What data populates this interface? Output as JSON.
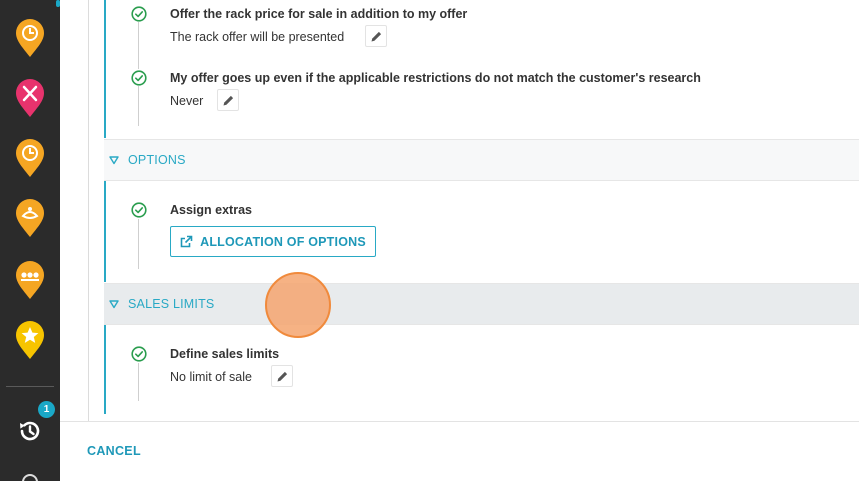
{
  "colors": {
    "sidebar_bg": "#2b2b2b",
    "accent": "#29a9c5",
    "link": "#1e98b8",
    "pin_orange": "#f5a623",
    "pin_pink": "#e8336d",
    "pin_yellow": "#f7c400",
    "cursor": "#f08a3c"
  },
  "sidebar": {
    "icons": [
      "clock-pin-icon",
      "restaurant-pin-icon",
      "clock-pin-icon",
      "spa-pin-icon",
      "group-pin-icon",
      "star-pin-icon"
    ],
    "history_badge": "1"
  },
  "rack_section": {
    "items": [
      {
        "title": "Offer the rack price for sale in addition to my offer",
        "value": "The rack offer will be presented"
      },
      {
        "title": "My offer goes up even if the applicable restrictions do not match the customer's research",
        "value": "Never"
      }
    ]
  },
  "options_section": {
    "title": "OPTIONS",
    "item_title": "Assign extras",
    "button_label": "ALLOCATION OF OPTIONS"
  },
  "sales_limits_section": {
    "title": "SALES LIMITS",
    "item_title": "Define sales limits",
    "item_value": "No limit of sale"
  },
  "footer": {
    "cancel_label": "CANCEL"
  }
}
